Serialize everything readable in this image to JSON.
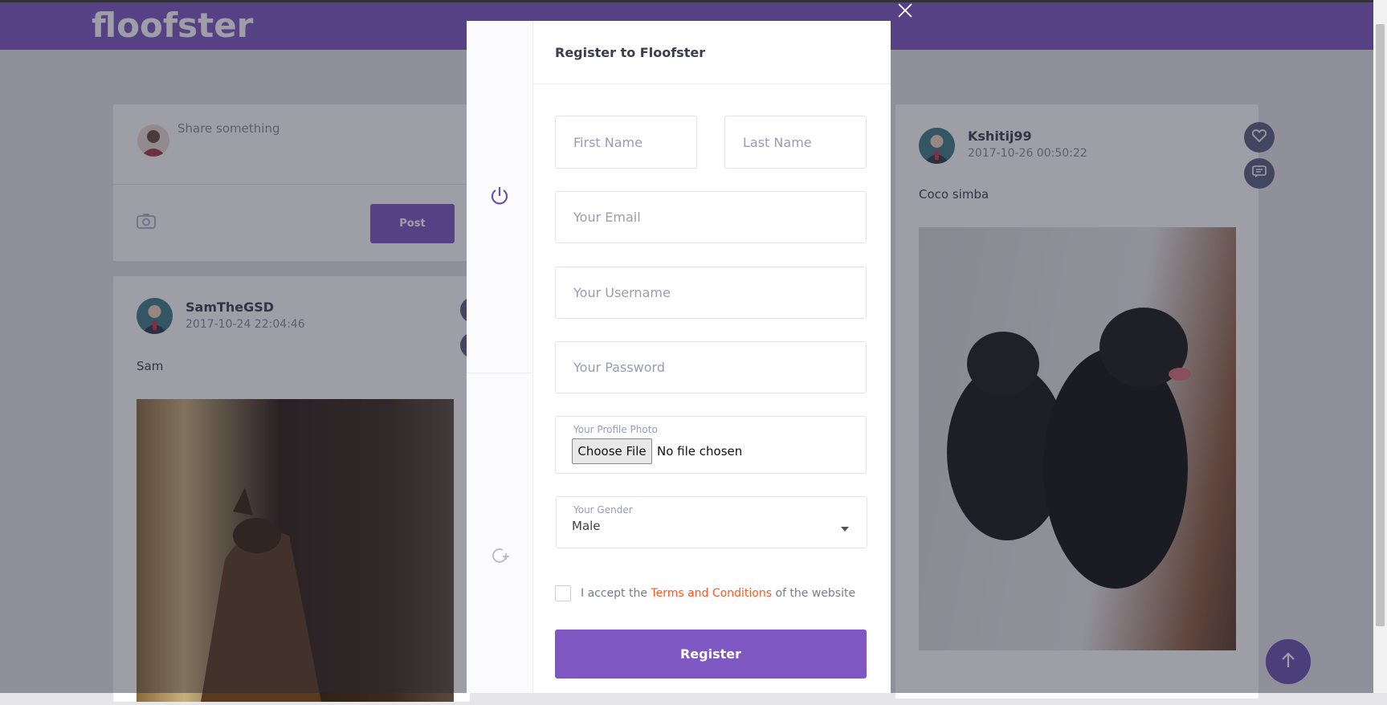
{
  "app": {
    "logo": "floofster"
  },
  "composer": {
    "placeholder": "Share something",
    "post_label": "Post"
  },
  "posts": [
    {
      "username": "SamTheGSD",
      "timestamp": "2017-10-24 22:04:46",
      "caption": "Sam"
    },
    {
      "username": "Kshitij99",
      "timestamp": "2017-10-26 00:50:22",
      "caption": "Coco simba"
    }
  ],
  "modal": {
    "title": "Register to Floofster",
    "first_name_placeholder": "First Name",
    "last_name_placeholder": "Last Name",
    "email_placeholder": "Your Email",
    "username_placeholder": "Your Username",
    "password_placeholder": "Your Password",
    "photo_label": "Your Profile Photo",
    "choose_file_label": "Choose File",
    "no_file_text": "No file chosen",
    "gender_label": "Your Gender",
    "gender_value": "Male",
    "terms_prefix": "I accept the",
    "terms_link": "Terms and Conditions",
    "terms_suffix": "of the website",
    "register_label": "Register"
  },
  "colors": {
    "brand": "#7e57c2",
    "link": "#ff5722"
  },
  "icons": [
    "camera-icon",
    "heart-icon",
    "comment-icon",
    "power-icon",
    "refresh-add-icon",
    "close-icon",
    "arrow-up-icon"
  ]
}
